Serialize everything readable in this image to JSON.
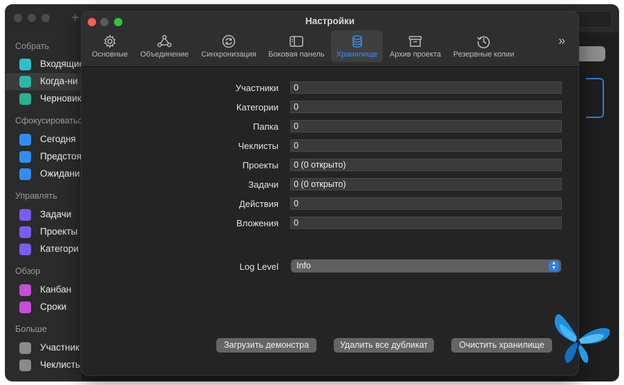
{
  "background_app": {
    "sidebar": {
      "sections": [
        {
          "title": "Собрать",
          "items": [
            {
              "label": "Входящие",
              "icon": "tray-icon",
              "color": "#30c0c8"
            },
            {
              "label": "Когда-ни",
              "icon": "question-icon",
              "color": "#2bb8a8",
              "selected": true
            },
            {
              "label": "Черновик",
              "icon": "draft-icon",
              "color": "#28b090"
            }
          ]
        },
        {
          "title": "Сфокусироваться",
          "items": [
            {
              "label": "Сегодня",
              "icon": "star-icon",
              "color": "#2f8ff0"
            },
            {
              "label": "Предстоя",
              "icon": "arrow-right-icon",
              "color": "#2f8ff0"
            },
            {
              "label": "Ожидани",
              "icon": "cup-icon",
              "color": "#2f8ff0"
            }
          ]
        },
        {
          "title": "Управлять",
          "items": [
            {
              "label": "Задачи",
              "icon": "checkbox-icon",
              "color": "#7b5cf0"
            },
            {
              "label": "Проекты",
              "icon": "project-icon",
              "color": "#7b5cf0"
            },
            {
              "label": "Категори",
              "icon": "grid-icon",
              "color": "#7b5cf0"
            }
          ]
        },
        {
          "title": "Обзор",
          "items": [
            {
              "label": "Канбан",
              "icon": "kanban-icon",
              "color": "#c64fd8"
            },
            {
              "label": "Сроки",
              "icon": "calendar-icon",
              "color": "#c64fd8"
            }
          ]
        },
        {
          "title": "Больше",
          "items": [
            {
              "label": "Участник",
              "icon": "person-icon",
              "color": "#8a8a8a"
            },
            {
              "label": "Чеклисть",
              "icon": "checklist-icon",
              "color": "#8a8a8a"
            }
          ]
        }
      ]
    }
  },
  "settings": {
    "title": "Настройки",
    "tabs": [
      {
        "label": "Основные",
        "icon": "gear-icon"
      },
      {
        "label": "Объединение",
        "icon": "merge-icon"
      },
      {
        "label": "Синхронизация",
        "icon": "sync-icon"
      },
      {
        "label": "Боковая панель",
        "icon": "sidebar-icon"
      },
      {
        "label": "Хранилище",
        "icon": "database-icon",
        "active": true
      },
      {
        "label": "Архив проекта",
        "icon": "archive-icon"
      },
      {
        "label": "Резервные копии",
        "icon": "history-icon"
      }
    ],
    "overflow_icon": "chevron-double-right-icon",
    "stats": [
      {
        "label": "Участники",
        "value": "0"
      },
      {
        "label": "Категории",
        "value": "0"
      },
      {
        "label": "Папка",
        "value": "0"
      },
      {
        "label": "Чеклисты",
        "value": "0"
      },
      {
        "label": "Проекты",
        "value": "0 (0 открыто)"
      },
      {
        "label": "Задачи",
        "value": "0 (0 открыто)"
      },
      {
        "label": "Действия",
        "value": "0"
      },
      {
        "label": "Вложения",
        "value": "0"
      }
    ],
    "log_level": {
      "label": "Log Level",
      "value": "Info"
    },
    "buttons": {
      "load_demo": "Загрузить демонстра",
      "remove_duplicates": "Удалить все дубликат",
      "clear_storage": "Очистить хранилище"
    },
    "accent_color": "#3b8ef6"
  }
}
